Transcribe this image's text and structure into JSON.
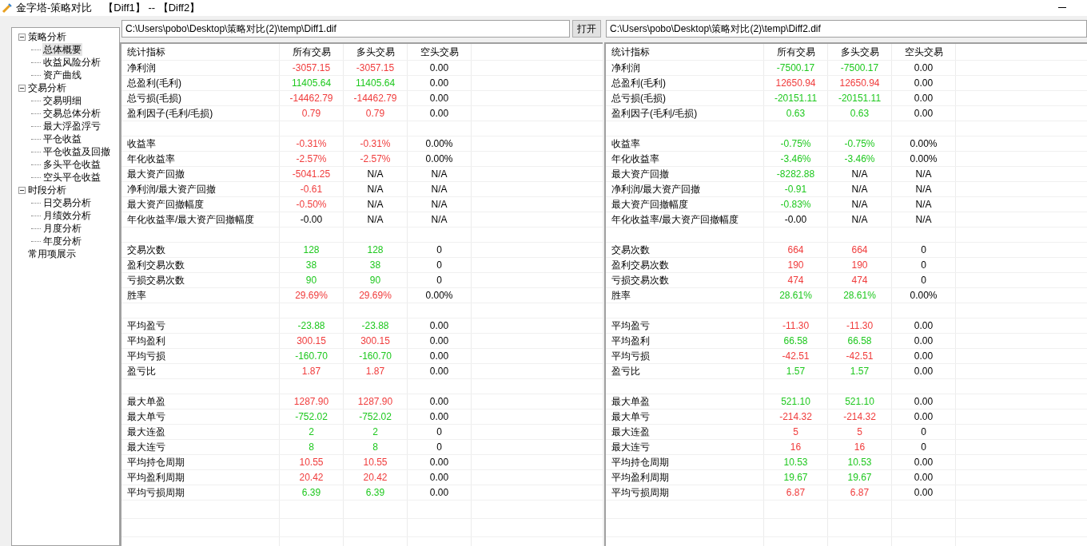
{
  "window": {
    "title": "金字塔-策略对比",
    "subtitle": "【Diff1】 -- 【Diff2】"
  },
  "tree": [
    {
      "label": "策略分析",
      "expanded": true,
      "selected": false,
      "children": [
        {
          "label": "总体概要",
          "selected": true
        },
        {
          "label": "收益风险分析",
          "selected": false
        },
        {
          "label": "资产曲线",
          "selected": false
        }
      ]
    },
    {
      "label": "交易分析",
      "expanded": true,
      "selected": false,
      "children": [
        {
          "label": "交易明细",
          "selected": false
        },
        {
          "label": "交易总体分析",
          "selected": false
        },
        {
          "label": "最大浮盈浮亏",
          "selected": false
        },
        {
          "label": "平仓收益",
          "selected": false
        },
        {
          "label": "平仓收益及回撤",
          "selected": false
        },
        {
          "label": "多头平仓收益",
          "selected": false
        },
        {
          "label": "空头平仓收益",
          "selected": false
        }
      ]
    },
    {
      "label": "时段分析",
      "expanded": true,
      "selected": false,
      "children": [
        {
          "label": "日交易分析",
          "selected": false
        },
        {
          "label": "月绩效分析",
          "selected": false
        },
        {
          "label": "月度分析",
          "selected": false
        },
        {
          "label": "年度分析",
          "selected": false
        }
      ]
    },
    {
      "label": "常用项展示",
      "selected": false
    }
  ],
  "panels": [
    {
      "path": "C:\\Users\\pobo\\Desktop\\策略对比(2)\\temp\\Diff1.dif",
      "open_button": "打开",
      "columns": [
        "统计指标",
        "所有交易",
        "多头交易",
        "空头交易"
      ],
      "rows": [
        {
          "kind": "data",
          "label": "净利润",
          "cells": [
            {
              "text": "-3057.15",
              "color": "#f03c3c"
            },
            {
              "text": "-3057.15",
              "color": "#f03c3c"
            },
            {
              "text": "0.00"
            }
          ]
        },
        {
          "kind": "data",
          "label": "总盈利(毛利)",
          "cells": [
            {
              "text": "11405.64",
              "color": "#1ec81e"
            },
            {
              "text": "11405.64",
              "color": "#1ec81e"
            },
            {
              "text": "0.00"
            }
          ]
        },
        {
          "kind": "data",
          "label": "总亏损(毛损)",
          "cells": [
            {
              "text": "-14462.79",
              "color": "#f03c3c"
            },
            {
              "text": "-14462.79",
              "color": "#f03c3c"
            },
            {
              "text": "0.00"
            }
          ]
        },
        {
          "kind": "data",
          "label": "盈利因子(毛利/毛损)",
          "cells": [
            {
              "text": "0.79",
              "color": "#f03c3c"
            },
            {
              "text": "0.79",
              "color": "#f03c3c"
            },
            {
              "text": "0.00"
            }
          ]
        },
        {
          "kind": "blank"
        },
        {
          "kind": "data",
          "label": "收益率",
          "cells": [
            {
              "text": "-0.31%",
              "color": "#f03c3c"
            },
            {
              "text": "-0.31%",
              "color": "#f03c3c"
            },
            {
              "text": "0.00%"
            }
          ]
        },
        {
          "kind": "data",
          "label": "年化收益率",
          "cells": [
            {
              "text": "-2.57%",
              "color": "#f03c3c"
            },
            {
              "text": "-2.57%",
              "color": "#f03c3c"
            },
            {
              "text": "0.00%"
            }
          ]
        },
        {
          "kind": "data",
          "label": "最大资产回撤",
          "cells": [
            {
              "text": "-5041.25",
              "color": "#f03c3c"
            },
            {
              "text": "N/A"
            },
            {
              "text": "N/A"
            }
          ]
        },
        {
          "kind": "data",
          "label": "净利润/最大资产回撤",
          "cells": [
            {
              "text": "-0.61",
              "color": "#f03c3c"
            },
            {
              "text": "N/A"
            },
            {
              "text": "N/A"
            }
          ]
        },
        {
          "kind": "data",
          "label": "最大资产回撤幅度",
          "cells": [
            {
              "text": "-0.50%",
              "color": "#f03c3c"
            },
            {
              "text": "N/A"
            },
            {
              "text": "N/A"
            }
          ]
        },
        {
          "kind": "data",
          "label": "年化收益率/最大资产回撤幅度",
          "cells": [
            {
              "text": "-0.00"
            },
            {
              "text": "N/A"
            },
            {
              "text": "N/A"
            }
          ]
        },
        {
          "kind": "blank"
        },
        {
          "kind": "data",
          "label": "交易次数",
          "cells": [
            {
              "text": "128",
              "color": "#1ec81e"
            },
            {
              "text": "128",
              "color": "#1ec81e"
            },
            {
              "text": "0"
            }
          ]
        },
        {
          "kind": "data",
          "label": "盈利交易次数",
          "cells": [
            {
              "text": "38",
              "color": "#1ec81e"
            },
            {
              "text": "38",
              "color": "#1ec81e"
            },
            {
              "text": "0"
            }
          ]
        },
        {
          "kind": "data",
          "label": "亏损交易次数",
          "cells": [
            {
              "text": "90",
              "color": "#1ec81e"
            },
            {
              "text": "90",
              "color": "#1ec81e"
            },
            {
              "text": "0"
            }
          ]
        },
        {
          "kind": "data",
          "label": "胜率",
          "cells": [
            {
              "text": "29.69%",
              "color": "#f03c3c"
            },
            {
              "text": "29.69%",
              "color": "#f03c3c"
            },
            {
              "text": "0.00%"
            }
          ]
        },
        {
          "kind": "blank"
        },
        {
          "kind": "data",
          "label": "平均盈亏",
          "cells": [
            {
              "text": "-23.88",
              "color": "#1ec81e"
            },
            {
              "text": "-23.88",
              "color": "#1ec81e"
            },
            {
              "text": "0.00"
            }
          ]
        },
        {
          "kind": "data",
          "label": "平均盈利",
          "cells": [
            {
              "text": "300.15",
              "color": "#f03c3c"
            },
            {
              "text": "300.15",
              "color": "#f03c3c"
            },
            {
              "text": "0.00"
            }
          ]
        },
        {
          "kind": "data",
          "label": "平均亏损",
          "cells": [
            {
              "text": "-160.70",
              "color": "#1ec81e"
            },
            {
              "text": "-160.70",
              "color": "#1ec81e"
            },
            {
              "text": "0.00"
            }
          ]
        },
        {
          "kind": "data",
          "label": "盈亏比",
          "cells": [
            {
              "text": "1.87",
              "color": "#f03c3c"
            },
            {
              "text": "1.87",
              "color": "#f03c3c"
            },
            {
              "text": "0.00"
            }
          ]
        },
        {
          "kind": "blank"
        },
        {
          "kind": "data",
          "label": "最大单盈",
          "cells": [
            {
              "text": "1287.90",
              "color": "#f03c3c"
            },
            {
              "text": "1287.90",
              "color": "#f03c3c"
            },
            {
              "text": "0.00"
            }
          ]
        },
        {
          "kind": "data",
          "label": "最大单亏",
          "cells": [
            {
              "text": "-752.02",
              "color": "#1ec81e"
            },
            {
              "text": "-752.02",
              "color": "#1ec81e"
            },
            {
              "text": "0.00"
            }
          ]
        },
        {
          "kind": "data",
          "label": "最大连盈",
          "cells": [
            {
              "text": "2",
              "color": "#1ec81e"
            },
            {
              "text": "2",
              "color": "#1ec81e"
            },
            {
              "text": "0"
            }
          ]
        },
        {
          "kind": "data",
          "label": "最大连亏",
          "cells": [
            {
              "text": "8",
              "color": "#1ec81e"
            },
            {
              "text": "8",
              "color": "#1ec81e"
            },
            {
              "text": "0"
            }
          ]
        },
        {
          "kind": "data",
          "label": "平均持仓周期",
          "cells": [
            {
              "text": "10.55",
              "color": "#f03c3c"
            },
            {
              "text": "10.55",
              "color": "#f03c3c"
            },
            {
              "text": "0.00"
            }
          ]
        },
        {
          "kind": "data",
          "label": "平均盈利周期",
          "cells": [
            {
              "text": "20.42",
              "color": "#f03c3c"
            },
            {
              "text": "20.42",
              "color": "#f03c3c"
            },
            {
              "text": "0.00"
            }
          ]
        },
        {
          "kind": "data",
          "label": "平均亏损周期",
          "cells": [
            {
              "text": "6.39",
              "color": "#1ec81e"
            },
            {
              "text": "6.39",
              "color": "#1ec81e"
            },
            {
              "text": "0.00"
            }
          ]
        }
      ]
    },
    {
      "path": "C:\\Users\\pobo\\Desktop\\策略对比(2)\\temp\\Diff2.dif",
      "columns": [
        "统计指标",
        "所有交易",
        "多头交易",
        "空头交易"
      ],
      "rows": [
        {
          "kind": "data",
          "label": "净利润",
          "cells": [
            {
              "text": "-7500.17",
              "color": "#1ec81e"
            },
            {
              "text": "-7500.17",
              "color": "#1ec81e"
            },
            {
              "text": "0.00"
            }
          ]
        },
        {
          "kind": "data",
          "label": "总盈利(毛利)",
          "cells": [
            {
              "text": "12650.94",
              "color": "#f03c3c"
            },
            {
              "text": "12650.94",
              "color": "#f03c3c"
            },
            {
              "text": "0.00"
            }
          ]
        },
        {
          "kind": "data",
          "label": "总亏损(毛损)",
          "cells": [
            {
              "text": "-20151.11",
              "color": "#1ec81e"
            },
            {
              "text": "-20151.11",
              "color": "#1ec81e"
            },
            {
              "text": "0.00"
            }
          ]
        },
        {
          "kind": "data",
          "label": "盈利因子(毛利/毛损)",
          "cells": [
            {
              "text": "0.63",
              "color": "#1ec81e"
            },
            {
              "text": "0.63",
              "color": "#1ec81e"
            },
            {
              "text": "0.00"
            }
          ]
        },
        {
          "kind": "blank"
        },
        {
          "kind": "data",
          "label": "收益率",
          "cells": [
            {
              "text": "-0.75%",
              "color": "#1ec81e"
            },
            {
              "text": "-0.75%",
              "color": "#1ec81e"
            },
            {
              "text": "0.00%"
            }
          ]
        },
        {
          "kind": "data",
          "label": "年化收益率",
          "cells": [
            {
              "text": "-3.46%",
              "color": "#1ec81e"
            },
            {
              "text": "-3.46%",
              "color": "#1ec81e"
            },
            {
              "text": "0.00%"
            }
          ]
        },
        {
          "kind": "data",
          "label": "最大资产回撤",
          "cells": [
            {
              "text": "-8282.88",
              "color": "#1ec81e"
            },
            {
              "text": "N/A"
            },
            {
              "text": "N/A"
            }
          ]
        },
        {
          "kind": "data",
          "label": "净利润/最大资产回撤",
          "cells": [
            {
              "text": "-0.91",
              "color": "#1ec81e"
            },
            {
              "text": "N/A"
            },
            {
              "text": "N/A"
            }
          ]
        },
        {
          "kind": "data",
          "label": "最大资产回撤幅度",
          "cells": [
            {
              "text": "-0.83%",
              "color": "#1ec81e"
            },
            {
              "text": "N/A"
            },
            {
              "text": "N/A"
            }
          ]
        },
        {
          "kind": "data",
          "label": "年化收益率/最大资产回撤幅度",
          "cells": [
            {
              "text": "-0.00"
            },
            {
              "text": "N/A"
            },
            {
              "text": "N/A"
            }
          ]
        },
        {
          "kind": "blank"
        },
        {
          "kind": "data",
          "label": "交易次数",
          "cells": [
            {
              "text": "664",
              "color": "#f03c3c"
            },
            {
              "text": "664",
              "color": "#f03c3c"
            },
            {
              "text": "0"
            }
          ]
        },
        {
          "kind": "data",
          "label": "盈利交易次数",
          "cells": [
            {
              "text": "190",
              "color": "#f03c3c"
            },
            {
              "text": "190",
              "color": "#f03c3c"
            },
            {
              "text": "0"
            }
          ]
        },
        {
          "kind": "data",
          "label": "亏损交易次数",
          "cells": [
            {
              "text": "474",
              "color": "#f03c3c"
            },
            {
              "text": "474",
              "color": "#f03c3c"
            },
            {
              "text": "0"
            }
          ]
        },
        {
          "kind": "data",
          "label": "胜率",
          "cells": [
            {
              "text": "28.61%",
              "color": "#1ec81e"
            },
            {
              "text": "28.61%",
              "color": "#1ec81e"
            },
            {
              "text": "0.00%"
            }
          ]
        },
        {
          "kind": "blank"
        },
        {
          "kind": "data",
          "label": "平均盈亏",
          "cells": [
            {
              "text": "-11.30",
              "color": "#f03c3c"
            },
            {
              "text": "-11.30",
              "color": "#f03c3c"
            },
            {
              "text": "0.00"
            }
          ]
        },
        {
          "kind": "data",
          "label": "平均盈利",
          "cells": [
            {
              "text": "66.58",
              "color": "#1ec81e"
            },
            {
              "text": "66.58",
              "color": "#1ec81e"
            },
            {
              "text": "0.00"
            }
          ]
        },
        {
          "kind": "data",
          "label": "平均亏损",
          "cells": [
            {
              "text": "-42.51",
              "color": "#f03c3c"
            },
            {
              "text": "-42.51",
              "color": "#f03c3c"
            },
            {
              "text": "0.00"
            }
          ]
        },
        {
          "kind": "data",
          "label": "盈亏比",
          "cells": [
            {
              "text": "1.57",
              "color": "#1ec81e"
            },
            {
              "text": "1.57",
              "color": "#1ec81e"
            },
            {
              "text": "0.00"
            }
          ]
        },
        {
          "kind": "blank"
        },
        {
          "kind": "data",
          "label": "最大单盈",
          "cells": [
            {
              "text": "521.10",
              "color": "#1ec81e"
            },
            {
              "text": "521.10",
              "color": "#1ec81e"
            },
            {
              "text": "0.00"
            }
          ]
        },
        {
          "kind": "data",
          "label": "最大单亏",
          "cells": [
            {
              "text": "-214.32",
              "color": "#f03c3c"
            },
            {
              "text": "-214.32",
              "color": "#f03c3c"
            },
            {
              "text": "0.00"
            }
          ]
        },
        {
          "kind": "data",
          "label": "最大连盈",
          "cells": [
            {
              "text": "5",
              "color": "#f03c3c"
            },
            {
              "text": "5",
              "color": "#f03c3c"
            },
            {
              "text": "0"
            }
          ]
        },
        {
          "kind": "data",
          "label": "最大连亏",
          "cells": [
            {
              "text": "16",
              "color": "#f03c3c"
            },
            {
              "text": "16",
              "color": "#f03c3c"
            },
            {
              "text": "0"
            }
          ]
        },
        {
          "kind": "data",
          "label": "平均持仓周期",
          "cells": [
            {
              "text": "10.53",
              "color": "#1ec81e"
            },
            {
              "text": "10.53",
              "color": "#1ec81e"
            },
            {
              "text": "0.00"
            }
          ]
        },
        {
          "kind": "data",
          "label": "平均盈利周期",
          "cells": [
            {
              "text": "19.67",
              "color": "#1ec81e"
            },
            {
              "text": "19.67",
              "color": "#1ec81e"
            },
            {
              "text": "0.00"
            }
          ]
        },
        {
          "kind": "data",
          "label": "平均亏损周期",
          "cells": [
            {
              "text": "6.87",
              "color": "#f03c3c"
            },
            {
              "text": "6.87",
              "color": "#f03c3c"
            },
            {
              "text": "0.00"
            }
          ]
        }
      ]
    }
  ]
}
